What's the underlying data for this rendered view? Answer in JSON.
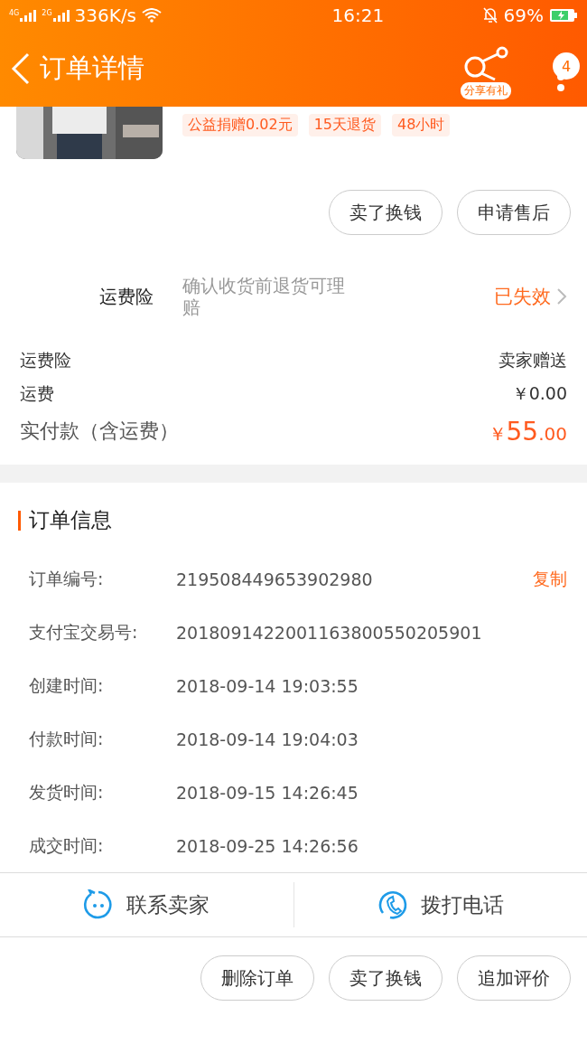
{
  "status_bar": {
    "network_1": "4G",
    "network_2": "2G",
    "speed": "336K/s",
    "time": "16:21",
    "battery": "69%"
  },
  "nav": {
    "title": "订单详情",
    "share_label": "分享有礼",
    "badge": "4"
  },
  "product": {
    "tags": [
      "公益捐赠0.02元",
      "15天退货",
      "48小时"
    ]
  },
  "product_actions": [
    "卖了换钱",
    "申请售后"
  ],
  "insurance": {
    "label": "运费险",
    "description": "确认收货前退货可理赔",
    "status": "已失效"
  },
  "fees": [
    {
      "label": "运费险",
      "value": "卖家赠送",
      "kind": "plain"
    },
    {
      "label": "运费",
      "value": "￥0.00",
      "kind": "plain"
    },
    {
      "label": "实付款（含运费）",
      "currency": "￥",
      "integer": "55",
      "decimals": ".00",
      "kind": "total"
    }
  ],
  "order_info": {
    "title": "订单信息",
    "copy_label": "复制",
    "rows": [
      {
        "label": "订单编号:",
        "value": "219508449653902980",
        "copyable": true
      },
      {
        "label": "支付宝交易号:",
        "value": "2018091422001163800550205901",
        "copyable": false
      },
      {
        "label": "创建时间:",
        "value": "2018-09-14 19:03:55",
        "copyable": false
      },
      {
        "label": "付款时间:",
        "value": "2018-09-14 19:04:03",
        "copyable": false
      },
      {
        "label": "发货时间:",
        "value": "2018-09-15 14:26:45",
        "copyable": false
      },
      {
        "label": "成交时间:",
        "value": "2018-09-25 14:26:56",
        "copyable": false
      }
    ]
  },
  "contact": [
    {
      "label": "联系卖家",
      "kind": "chat"
    },
    {
      "label": "拨打电话",
      "kind": "phone"
    }
  ],
  "bottom_actions": [
    "删除订单",
    "卖了换钱",
    "追加评价"
  ]
}
